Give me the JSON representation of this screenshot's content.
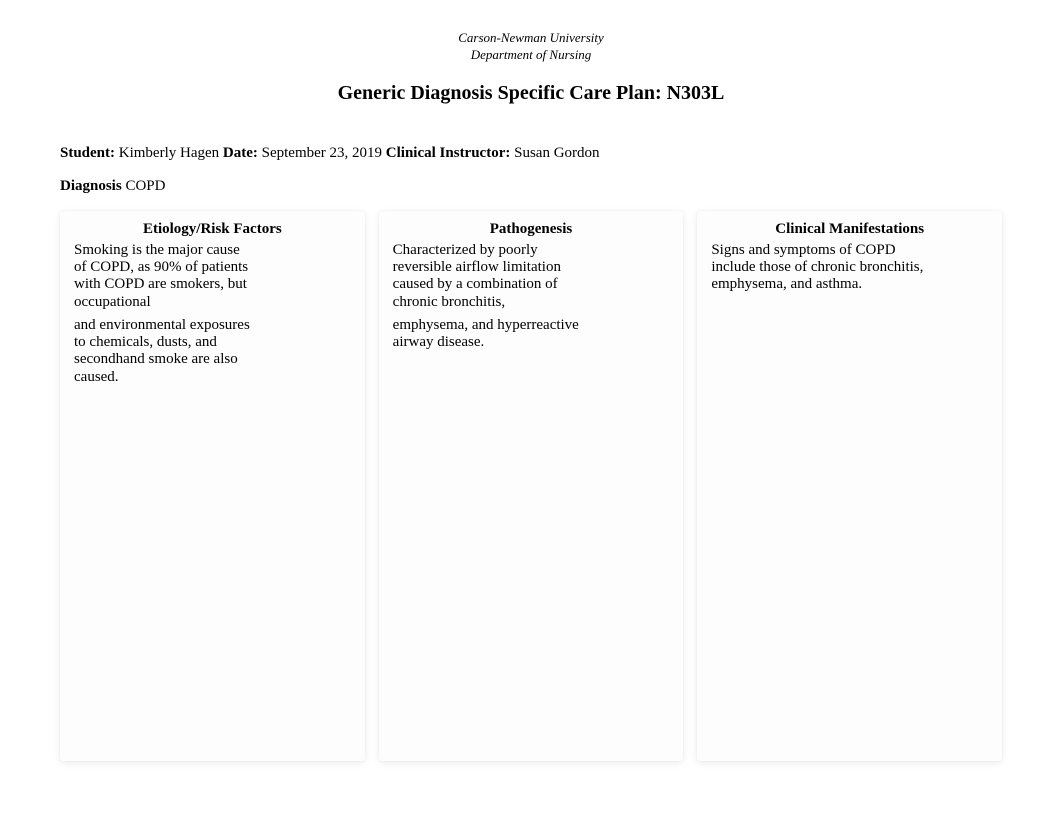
{
  "header": {
    "university": "Carson-Newman University",
    "department": "Department of Nursing",
    "title": "Generic Diagnosis Specific Care Plan: N303L"
  },
  "meta": {
    "student_label": "Student:",
    "student_value": "Kimberly Hagen",
    "date_label": "Date:",
    "date_value": "September 23, 2019",
    "instructor_label": "Clinical Instructor:",
    "instructor_value": "Susan Gordon",
    "diagnosis_label": "Diagnosis",
    "diagnosis_value": "COPD"
  },
  "columns": {
    "etiology": {
      "header": "Etiology/Risk Factors",
      "para1": "Smoking is the major cause of COPD, as 90% of patients with COPD are smokers, but occupational",
      "para2": "and environmental exposures to chemicals, dusts, and secondhand smoke are also caused."
    },
    "pathogenesis": {
      "header": "Pathogenesis",
      "para1": "Characterized by poorly reversible airflow limitation caused by a combination of chronic bronchitis,",
      "para2": "emphysema, and hyperreactive airway disease."
    },
    "manifestations": {
      "header": "Clinical Manifestations",
      "para1": "Signs and symptoms of COPD include those of chronic bronchitis, emphysema, and asthma."
    }
  }
}
